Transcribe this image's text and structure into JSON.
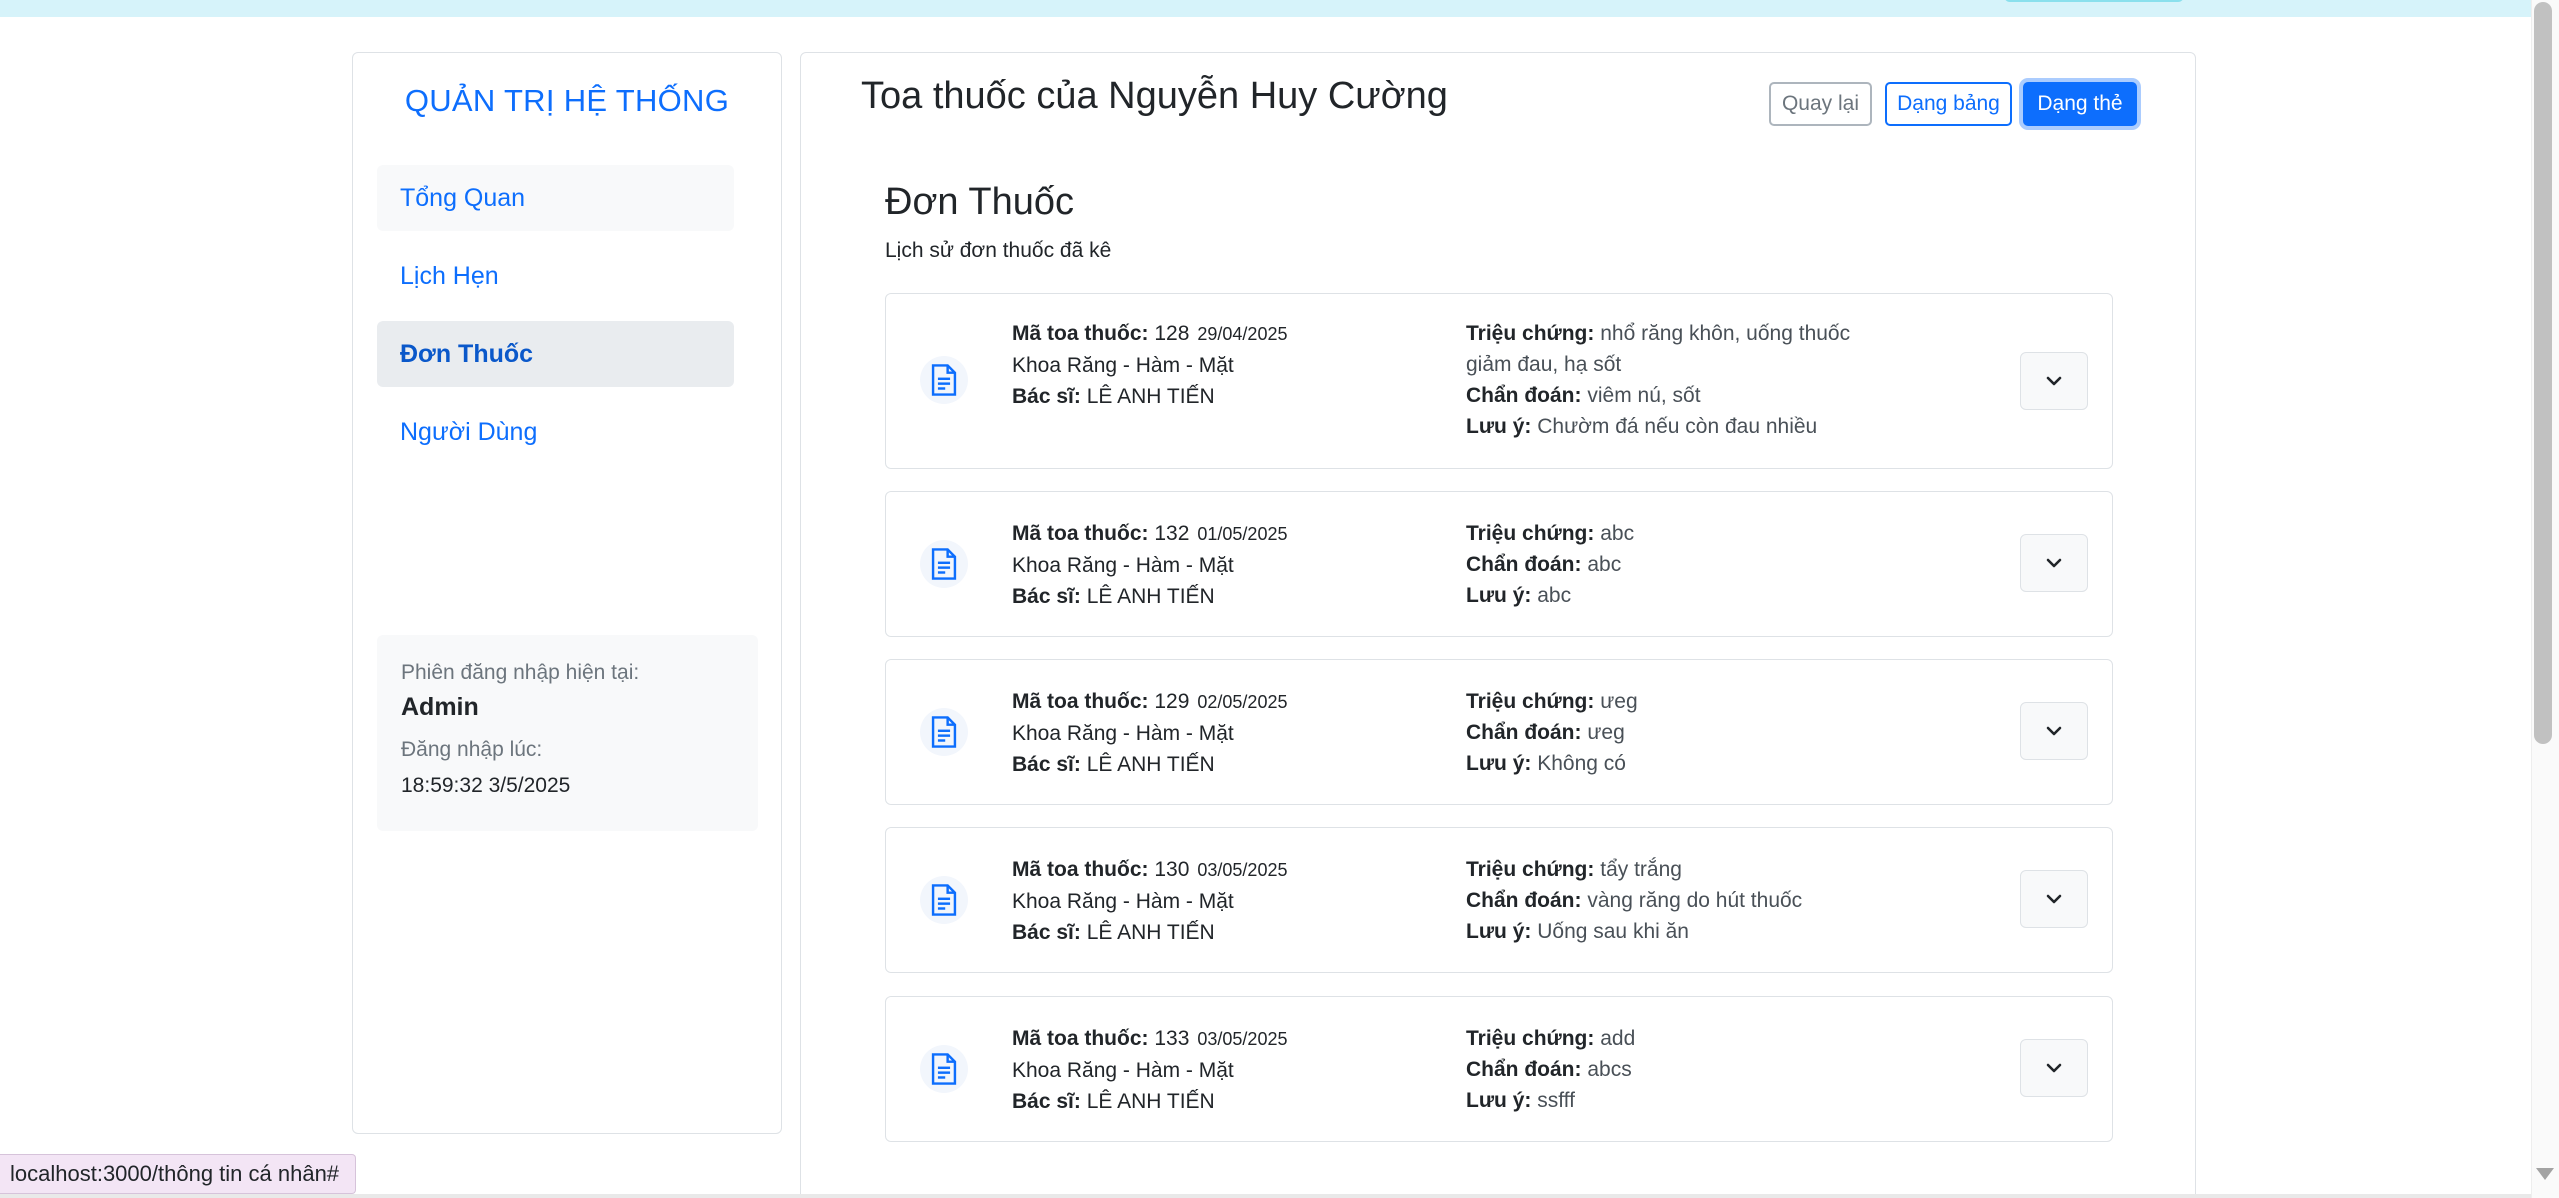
{
  "sidebar": {
    "title": "QUẢN TRỊ HỆ THỐNG",
    "items": [
      {
        "label": "Tổng Quan"
      },
      {
        "label": "Lịch Hẹn"
      },
      {
        "label": "Đơn Thuốc"
      },
      {
        "label": "Người Dùng"
      }
    ],
    "session": {
      "label": "Phiên đăng nhập hiện tại:",
      "user": "Admin",
      "login_label": "Đăng nhập lúc:",
      "login_time": "18:59:32 3/5/2025"
    }
  },
  "main": {
    "title": "Toa thuốc của Nguyễn Huy Cường",
    "buttons": {
      "back": "Quay lại",
      "table": "Dạng bảng",
      "card": "Dạng thẻ"
    },
    "section_title": "Đơn Thuốc",
    "section_subtitle": "Lịch sử đơn thuốc đã kê",
    "labels": {
      "code": "Mã toa thuốc:",
      "doctor": "Bác sĩ:",
      "symptom": "Triệu chứng:",
      "diagnosis": "Chẩn đoán:",
      "note": "Lưu ý:"
    },
    "prescriptions": [
      {
        "code": "128",
        "date": "29/04/2025",
        "department": "Khoa Răng - Hàm - Mặt",
        "doctor": "LÊ ANH TIẾN",
        "symptom": "nhổ răng khôn, uống thuốc giảm đau, hạ sốt",
        "diagnosis": "viêm nú, sốt",
        "note": "Chườm đá nếu còn đau nhiều"
      },
      {
        "code": "132",
        "date": "01/05/2025",
        "department": "Khoa Răng - Hàm - Mặt",
        "doctor": "LÊ ANH TIẾN",
        "symptom": "abc",
        "diagnosis": "abc",
        "note": "abc"
      },
      {
        "code": "129",
        "date": "02/05/2025",
        "department": "Khoa Răng - Hàm - Mặt",
        "doctor": "LÊ ANH TIẾN",
        "symptom": "ưeg",
        "diagnosis": "ưeg",
        "note": "Không có"
      },
      {
        "code": "130",
        "date": "03/05/2025",
        "department": "Khoa Răng - Hàm - Mặt",
        "doctor": "LÊ ANH TIẾN",
        "symptom": "tẩy trắng",
        "diagnosis": "vàng răng do hút thuốc",
        "note": "Uống sau khi ăn"
      },
      {
        "code": "133",
        "date": "03/05/2025",
        "department": "Khoa Răng - Hàm - Mặt",
        "doctor": "LÊ ANH TIẾN",
        "symptom": "add",
        "diagnosis": "abcs",
        "note": "ssfff"
      }
    ]
  },
  "status_bar": {
    "url": "localhost:3000/thông tin cá nhân#"
  },
  "colors": {
    "primary": "#0d6efd",
    "topbar": "#d6f3fa",
    "status_bg": "#f3e5f5"
  },
  "icons": [
    "document-icon",
    "chevron-down-icon"
  ]
}
